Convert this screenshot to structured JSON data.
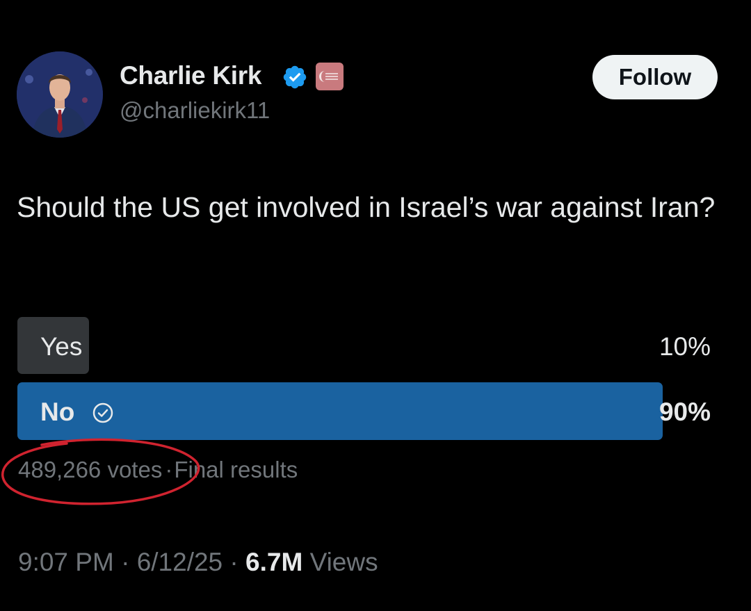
{
  "author": {
    "display_name": "Charlie Kirk",
    "handle": "@charliekirk11",
    "verified_icon": "verified-badge-icon",
    "affiliate_badge_icon": "affiliation-badge-icon"
  },
  "follow_button": {
    "label": "Follow"
  },
  "tweet": {
    "text": "Should the US get involved in Israel’s war against Iran?"
  },
  "poll": {
    "options": [
      {
        "label": "Yes",
        "percent_label": "10%",
        "fraction": 0.1,
        "selected": false
      },
      {
        "label": "No",
        "percent_label": "90%",
        "fraction": 0.9,
        "selected": true,
        "icon": "check-circle-icon"
      }
    ],
    "votes": "489,266 votes",
    "separator": "·",
    "status": "Final results"
  },
  "footer": {
    "time": "9:07 PM",
    "date": "6/12/25",
    "separator": "·",
    "views_count": "6.7M",
    "views_label": "Views"
  },
  "colors": {
    "background": "#000000",
    "primary_text": "#e7e9ea",
    "secondary_text": "#71767b",
    "winning_bar": "#1a62a0",
    "losing_bar": "#333639",
    "verified_blue": "#1d9bf0",
    "annotation_red": "#d0232f"
  }
}
